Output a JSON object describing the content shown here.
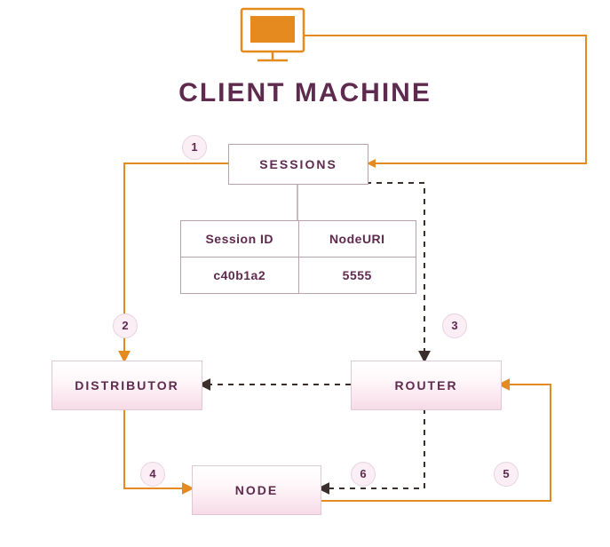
{
  "title": "CLIENT MACHINE",
  "steps": {
    "s1": "1",
    "s2": "2",
    "s3": "3",
    "s4": "4",
    "s5": "5",
    "s6": "6"
  },
  "boxes": {
    "sessions": "SESSIONS",
    "distributor": "DISTRIBUTOR",
    "router": "ROUTER",
    "node": "NODE"
  },
  "table": {
    "headers": {
      "col1": "Session ID",
      "col2": "NodeURI"
    },
    "row": {
      "col1": "c40b1a2",
      "col2": "5555"
    }
  },
  "colors": {
    "orange": "#e58a1f",
    "purple": "#5e2a4e",
    "darkdash": "#3a2f2a"
  }
}
